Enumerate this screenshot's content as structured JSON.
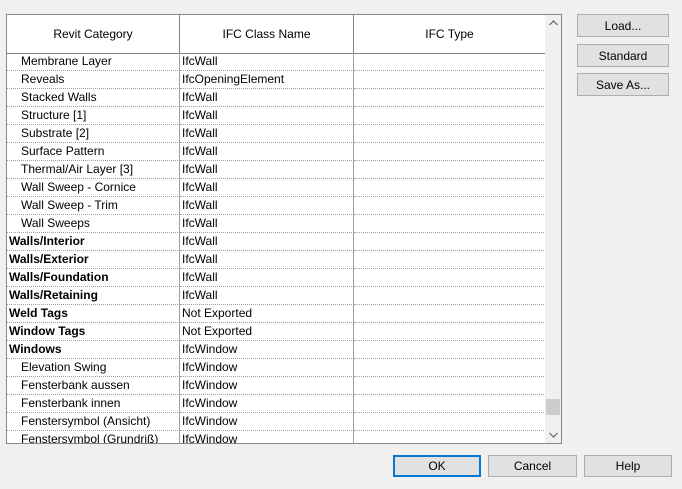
{
  "grid": {
    "columns": [
      "Revit Category",
      "IFC Class Name",
      "IFC Type"
    ],
    "rows": [
      {
        "category": "Membrane Layer",
        "ifc_class": "IfcWall",
        "ifc_type": "",
        "level": "sub"
      },
      {
        "category": "Reveals",
        "ifc_class": "IfcOpeningElement",
        "ifc_type": "",
        "level": "sub"
      },
      {
        "category": "Stacked Walls",
        "ifc_class": "IfcWall",
        "ifc_type": "",
        "level": "sub"
      },
      {
        "category": "Structure [1]",
        "ifc_class": "IfcWall",
        "ifc_type": "",
        "level": "sub"
      },
      {
        "category": "Substrate [2]",
        "ifc_class": "IfcWall",
        "ifc_type": "",
        "level": "sub"
      },
      {
        "category": "Surface Pattern",
        "ifc_class": "IfcWall",
        "ifc_type": "",
        "level": "sub"
      },
      {
        "category": "Thermal/Air Layer [3]",
        "ifc_class": "IfcWall",
        "ifc_type": "",
        "level": "sub"
      },
      {
        "category": "Wall Sweep - Cornice",
        "ifc_class": "IfcWall",
        "ifc_type": "",
        "level": "sub"
      },
      {
        "category": "Wall Sweep - Trim",
        "ifc_class": "IfcWall",
        "ifc_type": "",
        "level": "sub"
      },
      {
        "category": "Wall Sweeps",
        "ifc_class": "IfcWall",
        "ifc_type": "",
        "level": "sub"
      },
      {
        "category": "Walls/Interior",
        "ifc_class": "IfcWall",
        "ifc_type": "",
        "level": "top"
      },
      {
        "category": "Walls/Exterior",
        "ifc_class": "IfcWall",
        "ifc_type": "",
        "level": "top"
      },
      {
        "category": "Walls/Foundation",
        "ifc_class": "IfcWall",
        "ifc_type": "",
        "level": "top"
      },
      {
        "category": "Walls/Retaining",
        "ifc_class": "IfcWall",
        "ifc_type": "",
        "level": "top"
      },
      {
        "category": "Weld Tags",
        "ifc_class": "Not Exported",
        "ifc_type": "",
        "level": "top"
      },
      {
        "category": "Window Tags",
        "ifc_class": "Not Exported",
        "ifc_type": "",
        "level": "top"
      },
      {
        "category": "Windows",
        "ifc_class": "IfcWindow",
        "ifc_type": "",
        "level": "top"
      },
      {
        "category": "Elevation Swing",
        "ifc_class": "IfcWindow",
        "ifc_type": "",
        "level": "sub"
      },
      {
        "category": "Fensterbank aussen",
        "ifc_class": "IfcWindow",
        "ifc_type": "",
        "level": "sub"
      },
      {
        "category": "Fensterbank innen",
        "ifc_class": "IfcWindow",
        "ifc_type": "",
        "level": "sub"
      },
      {
        "category": "Fenstersymbol (Ansicht)",
        "ifc_class": "IfcWindow",
        "ifc_type": "",
        "level": "sub"
      },
      {
        "category": "Fenstersymbol (Grundriß)",
        "ifc_class": "IfcWindow",
        "ifc_type": "",
        "level": "sub"
      }
    ]
  },
  "side_buttons": {
    "load": "Load...",
    "standard": "Standard",
    "save_as": "Save As..."
  },
  "footer_buttons": {
    "ok": "OK",
    "cancel": "Cancel",
    "help": "Help"
  },
  "icons": {
    "scroll_up": "chevron-up-icon",
    "scroll_down": "chevron-down-icon"
  }
}
